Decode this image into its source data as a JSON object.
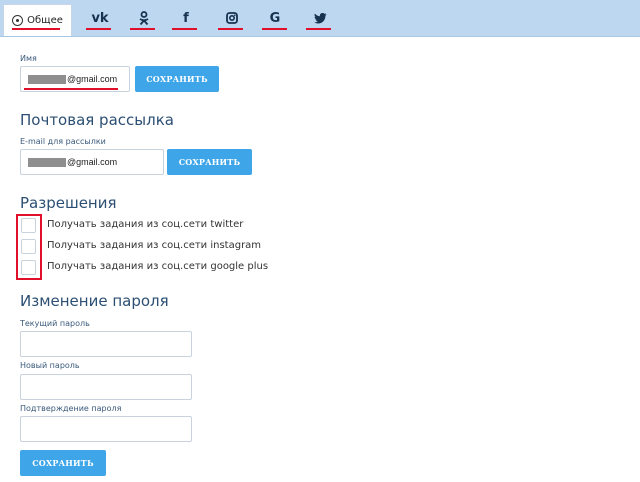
{
  "tabs": [
    {
      "id": "general",
      "label": "Общее",
      "icon": "gear-icon"
    },
    {
      "id": "vk",
      "glyph": "vk",
      "icon": "vk-icon"
    },
    {
      "id": "ok",
      "icon": "odnoklassniki-icon"
    },
    {
      "id": "facebook",
      "glyph": "f",
      "icon": "facebook-icon"
    },
    {
      "id": "instagram",
      "icon": "instagram-icon"
    },
    {
      "id": "google",
      "glyph": "G",
      "icon": "google-icon"
    },
    {
      "id": "twitter",
      "icon": "twitter-icon"
    }
  ],
  "name_section": {
    "label": "Имя",
    "value_suffix": "@gmail.com",
    "save_label": "СОХРАНИТЬ"
  },
  "mailing": {
    "title": "Почтовая рассылка",
    "label": "E-mail для рассылки",
    "value_suffix": "@gmail.com",
    "save_label": "СОХРАНИТЬ"
  },
  "permissions": {
    "title": "Разрешения",
    "items": [
      {
        "label": "Получать задания из соц.сети twitter",
        "checked": false
      },
      {
        "label": "Получать задания из соц.сети instagram",
        "checked": false
      },
      {
        "label": "Получать задания из соц.сети google plus",
        "checked": false
      }
    ]
  },
  "password": {
    "title": "Изменение пароля",
    "current_label": "Текущий пароль",
    "new_label": "Новый пароль",
    "confirm_label": "Подтверждение пароля",
    "save_label": "СОХРАНИТЬ"
  },
  "colors": {
    "accent": "#3ea6e8",
    "highlight": "#e0102a",
    "tabbar": "#bcd7ef",
    "heading": "#2c4f73"
  }
}
